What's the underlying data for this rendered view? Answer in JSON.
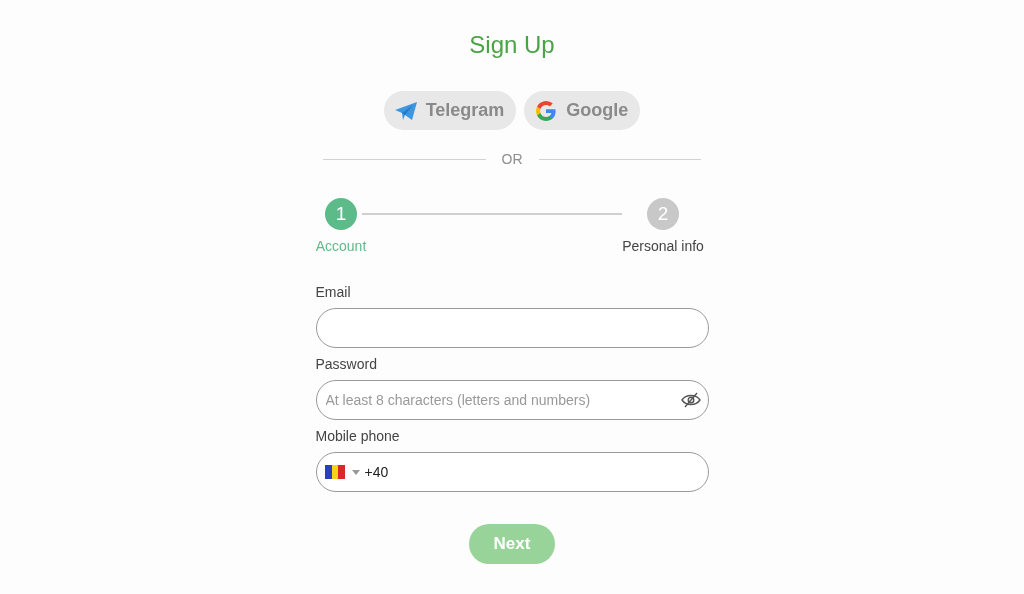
{
  "title": "Sign Up",
  "social_buttons": [
    {
      "kind": "telegram",
      "label": "Telegram"
    },
    {
      "kind": "google",
      "label": "Google"
    }
  ],
  "divider_text": "OR",
  "steps": [
    {
      "number": "1",
      "label": "Account",
      "selected": true
    },
    {
      "number": "2",
      "label": "Personal info",
      "selected": false
    }
  ],
  "fields": [
    {
      "kind": "text",
      "label": "Email"
    },
    {
      "kind": "password",
      "label": "Password",
      "placeholder": "At least 8 characters (letters and numbers)"
    },
    {
      "kind": "phone",
      "label": "Mobile phone",
      "value": "+40"
    }
  ],
  "next_button": {
    "label": "Next",
    "disabled": true
  }
}
